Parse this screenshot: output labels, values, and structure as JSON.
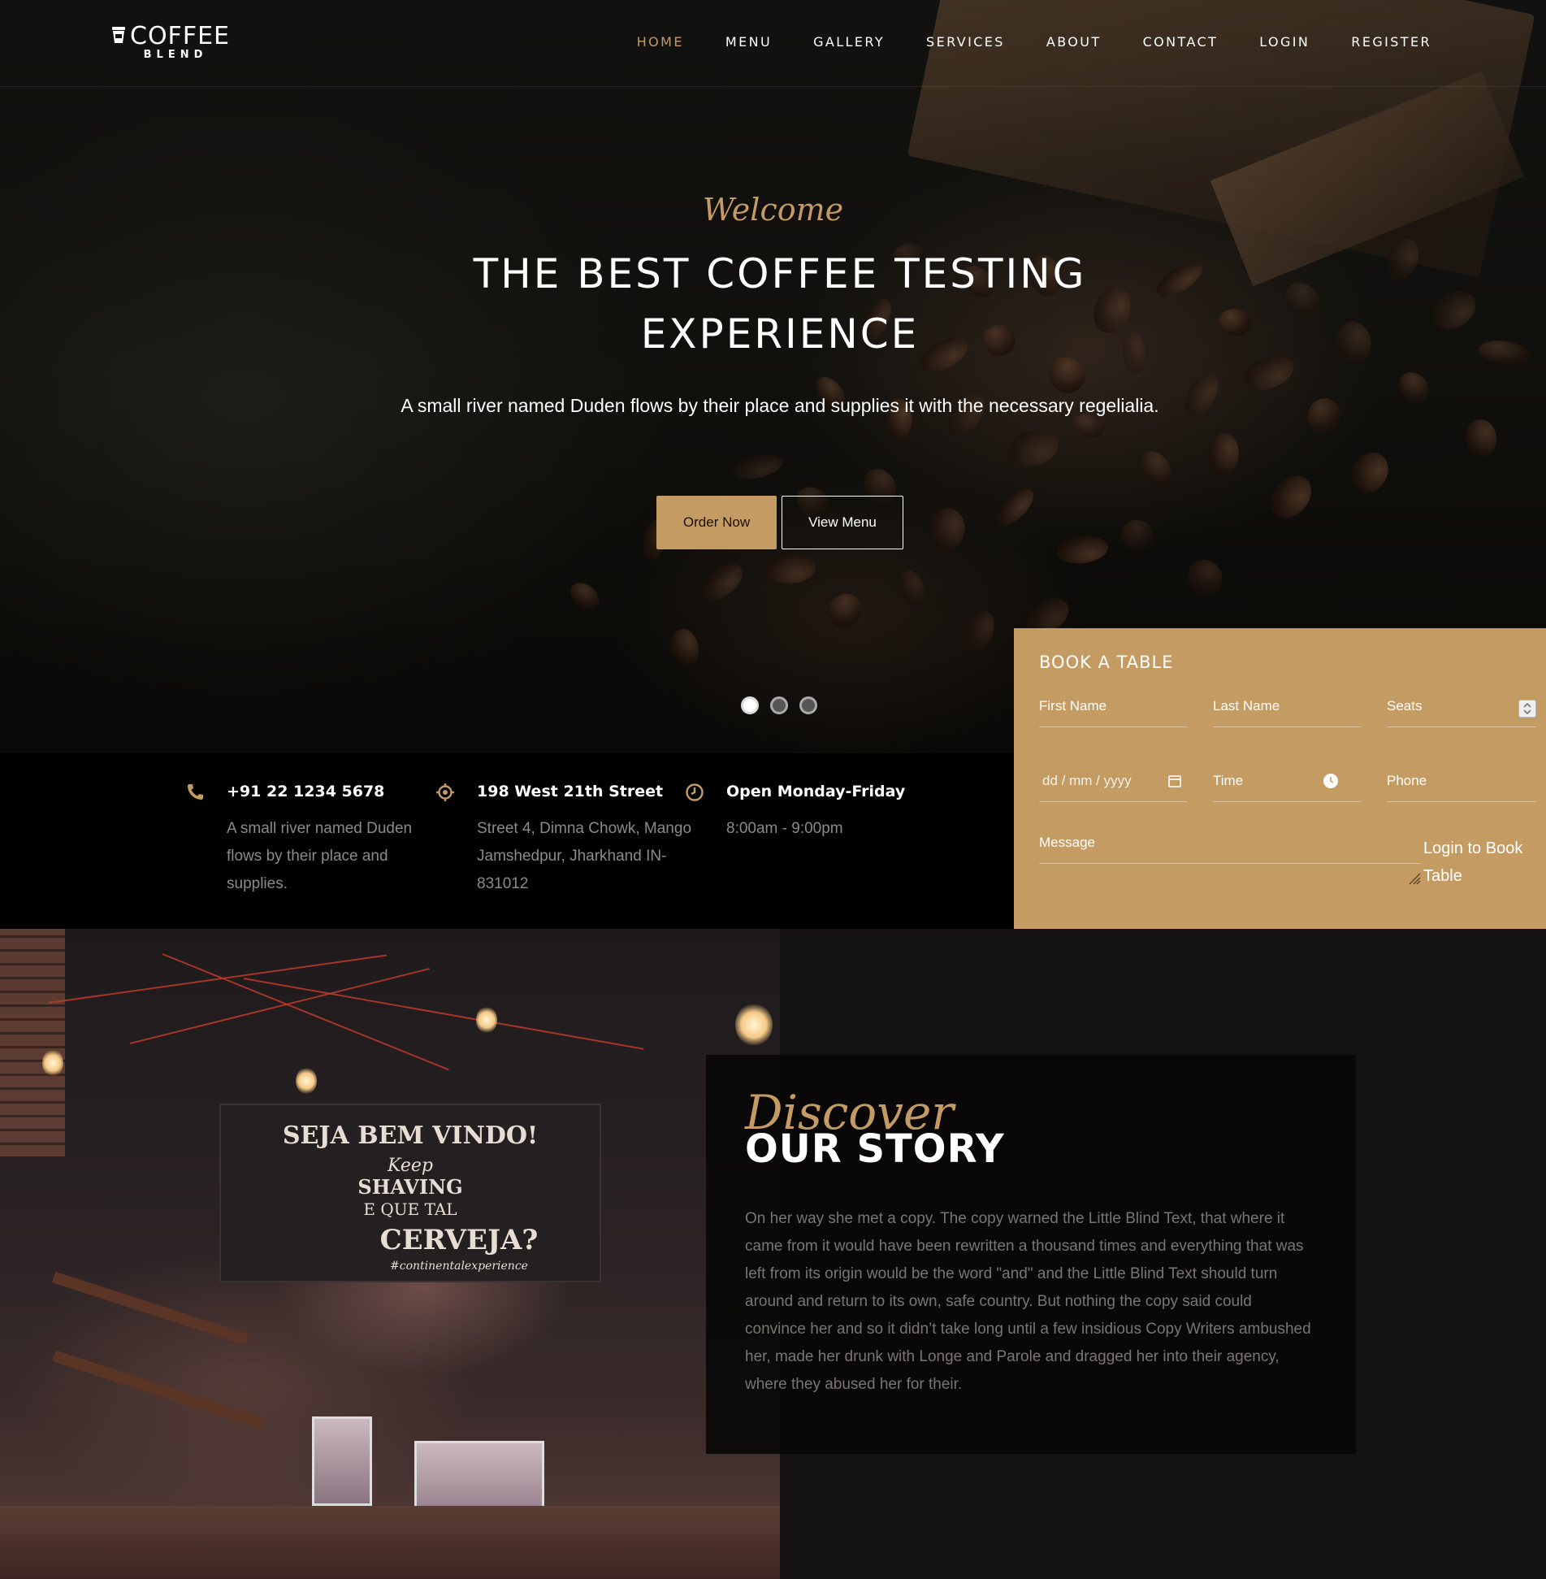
{
  "brand": {
    "name": "COFFEE",
    "sub": "BLEND"
  },
  "nav": {
    "items": [
      {
        "label": "HOME",
        "active": true
      },
      {
        "label": "MENU"
      },
      {
        "label": "GALLERY"
      },
      {
        "label": "SERVICES"
      },
      {
        "label": "ABOUT"
      },
      {
        "label": "CONTACT"
      },
      {
        "label": "LOGIN"
      },
      {
        "label": "REGISTER"
      }
    ]
  },
  "hero": {
    "welcome": "Welcome",
    "title": "THE BEST COFFEE TESTING EXPERIENCE",
    "subtitle": "A small river named Duden flows by their place and supplies it with the necessary regelialia.",
    "order_button": "Order Now",
    "menu_button": "View Menu",
    "slides": 3,
    "active_slide": 1
  },
  "info": [
    {
      "icon": "phone-icon",
      "heading": "+91 22 1234 5678",
      "text": "A small river named Duden flows by their place and supplies."
    },
    {
      "icon": "location-icon",
      "heading": "198 West 21th Street",
      "text": "Street 4, Dimna Chowk, Mango Jamshedpur, Jharkhand IN-831012"
    },
    {
      "icon": "clock-icon",
      "heading": "Open Monday-Friday",
      "text": "8:00am - 9:00pm"
    }
  ],
  "booking": {
    "title": "BOOK A TABLE",
    "first_name": "First Name",
    "last_name": "Last Name",
    "seats": "Seats",
    "date": "dd / mm / yyyy",
    "time": "Time",
    "phone": "Phone",
    "message": "Message",
    "login": "Login to Book Table"
  },
  "story": {
    "kicker": "Discover",
    "title": "OUR STORY",
    "text": "On her way she met a copy. The copy warned the Little Blind Text, that where it came from it would have been rewritten a thousand times and everything that was left from its origin would be the word \"and\" and the Little Blind Text should turn around and return to its own, safe country. But nothing the copy said could convince her and so it didn’t take long until a few insidious Copy Writers ambushed her, made her drunk with Longe and Parole and dragged her into their agency, where they abused her for their."
  },
  "colors": {
    "accent": "#c49b63",
    "dark": "#000000"
  }
}
